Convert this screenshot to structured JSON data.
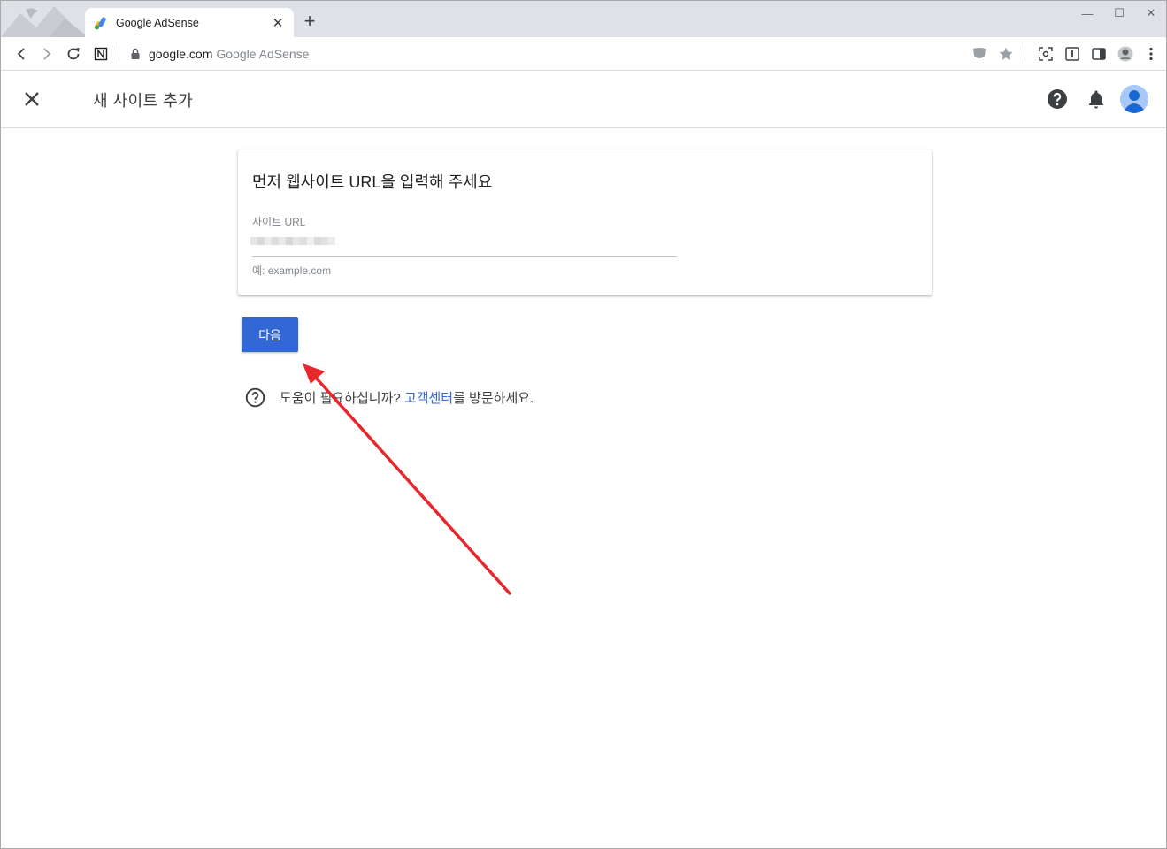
{
  "browser": {
    "tab_title": "Google AdSense",
    "tab_close": "✕",
    "new_tab": "+",
    "url_domain": "google.com",
    "url_page_title": "Google AdSense",
    "window_controls": {
      "minimize": "—",
      "maximize": "☐",
      "close": "✕"
    }
  },
  "header": {
    "title": "새 사이트 추가"
  },
  "form": {
    "heading": "먼저 웹사이트 URL을 입력해 주세요",
    "field_label": "사이트 URL",
    "field_hint": "예: example.com"
  },
  "actions": {
    "next_label": "다음"
  },
  "help": {
    "prefix": "도움이 필요하십니까? ",
    "link": "고객센터",
    "suffix": "를 방문하세요."
  },
  "colors": {
    "primary_button": "#3367d6",
    "annotation_arrow": "#e8262b",
    "avatar": "#a8c7fa"
  }
}
